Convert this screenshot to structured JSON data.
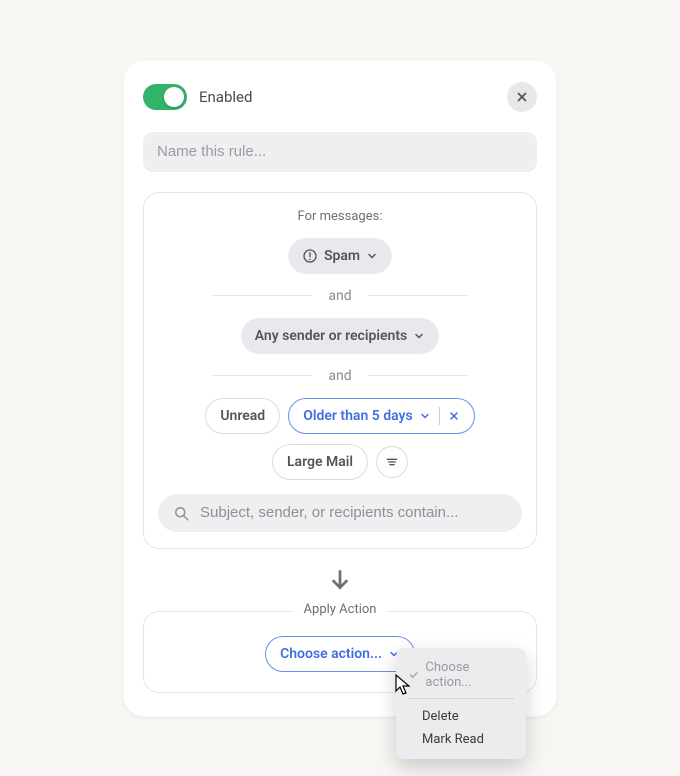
{
  "header": {
    "enabled_label": "Enabled",
    "toggle_on": true
  },
  "rule_name_placeholder": "Name this rule...",
  "conditions": {
    "title": "For messages:",
    "spam_pill": "Spam",
    "and_label": "and",
    "sender_pill": "Any sender or recipients",
    "filters": {
      "unread": "Unread",
      "older_than": "Older than 5 days",
      "large_mail": "Large Mail"
    },
    "search_placeholder": "Subject, sender, or recipients contain..."
  },
  "action": {
    "title": "Apply Action",
    "button_label": "Choose action..."
  },
  "popup": {
    "header": "Choose action...",
    "items": [
      "Delete",
      "Mark Read"
    ]
  }
}
